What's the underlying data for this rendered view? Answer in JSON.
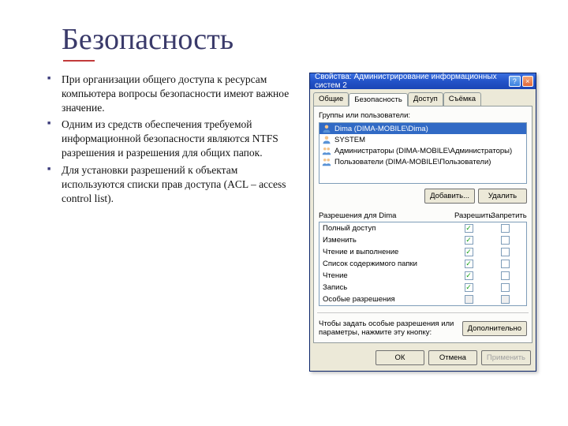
{
  "slide": {
    "title": "Безопасность",
    "bullets": [
      "При организации общего доступа к ресурсам компьютера вопросы безопасности имеют важное значение.",
      "Одним из средств обеспечения требуемой информационной безопасности являются NTFS разрешения и разрешения для общих папок.",
      "Для установки разрешений к объектам используются списки прав доступа (ACL – access control list)."
    ]
  },
  "dialog": {
    "title": "Свойства: Администрирование информационных систем 2",
    "close_x": "×",
    "help_q": "?",
    "tabs": [
      "Общие",
      "Безопасность",
      "Доступ",
      "Съёмка"
    ],
    "active_tab": 1,
    "group_label": "Группы или пользователи:",
    "users": [
      {
        "icon": "user",
        "label": "Dima (DIMA-MOBILE\\Dima)",
        "selected": true
      },
      {
        "icon": "user",
        "label": "SYSTEM",
        "selected": false
      },
      {
        "icon": "group",
        "label": "Администраторы (DIMA-MOBILE\\Администраторы)",
        "selected": false
      },
      {
        "icon": "group",
        "label": "Пользователи (DIMA-MOBILE\\Пользователи)",
        "selected": false
      }
    ],
    "add_btn": "Добавить...",
    "remove_btn": "Удалить",
    "perm_label": "Разрешения для Dima",
    "col_allow": "Разрешить",
    "col_deny": "Запретить",
    "permissions": [
      {
        "name": "Полный доступ",
        "allow": true,
        "deny": false
      },
      {
        "name": "Изменить",
        "allow": true,
        "deny": false
      },
      {
        "name": "Чтение и выполнение",
        "allow": true,
        "deny": false
      },
      {
        "name": "Список содержимого папки",
        "allow": true,
        "deny": false
      },
      {
        "name": "Чтение",
        "allow": true,
        "deny": false
      },
      {
        "name": "Запись",
        "allow": true,
        "deny": false
      },
      {
        "name": "Особые разрешения",
        "allow": false,
        "deny": false
      }
    ],
    "hint": "Чтобы задать особые разрешения или параметры, нажмите эту кнопку:",
    "advanced_btn": "Дополнительно",
    "ok_btn": "ОК",
    "cancel_btn": "Отмена",
    "apply_btn": "Применить"
  }
}
